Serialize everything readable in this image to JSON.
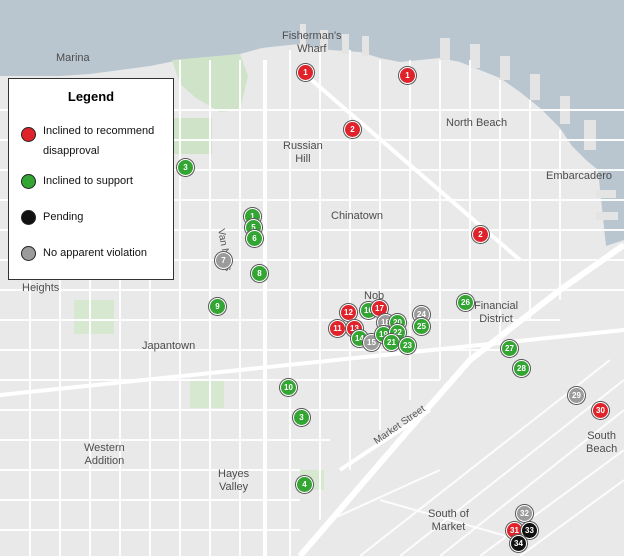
{
  "colors": {
    "water": "#b9c6d0",
    "land": "#e9e9e9",
    "park": "#cfe3c9",
    "road": "#ffffff",
    "red": "#e0232a",
    "green": "#33a532",
    "black": "#111111",
    "gray": "#9b9b9b"
  },
  "legend": {
    "title": "Legend",
    "items": [
      {
        "label": "Inclined to recommend disapproval",
        "line1": "Inclined to recommend",
        "line2": "disapproval",
        "color": "#e0232a",
        "icon": "red-circle-icon"
      },
      {
        "label": "Inclined to support",
        "color": "#33a532",
        "icon": "green-circle-icon"
      },
      {
        "label": "Pending",
        "color": "#111111",
        "icon": "black-circle-icon"
      },
      {
        "label": "No apparent violation",
        "color": "#9b9b9b",
        "icon": "gray-circle-icon"
      }
    ]
  },
  "places": [
    {
      "id": "marina",
      "text": "Marina"
    },
    {
      "id": "fishermans",
      "text": "Fisherman's\nWharf"
    },
    {
      "id": "north-beach",
      "text": "North Beach"
    },
    {
      "id": "russian-hill",
      "text": "Russian\nHill"
    },
    {
      "id": "embarcadero",
      "text": "Embarcadero"
    },
    {
      "id": "chinatown",
      "text": "Chinatown"
    },
    {
      "id": "heights",
      "text": "Heights"
    },
    {
      "id": "nob",
      "text": "Nob"
    },
    {
      "id": "financial",
      "text": "Financial\nDistrict"
    },
    {
      "id": "japantown",
      "text": "Japantown"
    },
    {
      "id": "western",
      "text": "Western\nAddition"
    },
    {
      "id": "hayes",
      "text": "Hayes\nValley"
    },
    {
      "id": "south-beach",
      "text": "South\nBeach"
    },
    {
      "id": "som",
      "text": "South of\nMarket"
    }
  ],
  "streets": [
    {
      "id": "van-ness",
      "text": "Van Ness"
    },
    {
      "id": "market",
      "text": "Market Street"
    }
  ],
  "markers": [
    {
      "n": "1",
      "status": "red"
    },
    {
      "n": "1",
      "status": "red"
    },
    {
      "n": "2",
      "status": "red"
    },
    {
      "n": "2",
      "status": "red"
    },
    {
      "n": "3",
      "status": "green"
    },
    {
      "n": "1",
      "status": "green"
    },
    {
      "n": "5",
      "status": "green"
    },
    {
      "n": "6",
      "status": "green"
    },
    {
      "n": "7",
      "status": "gray"
    },
    {
      "n": "8",
      "status": "green"
    },
    {
      "n": "9",
      "status": "green"
    },
    {
      "n": "26",
      "status": "green"
    },
    {
      "n": "12",
      "status": "red"
    },
    {
      "n": "16",
      "status": "green"
    },
    {
      "n": "17",
      "status": "red"
    },
    {
      "n": "24",
      "status": "gray"
    },
    {
      "n": "11",
      "status": "red"
    },
    {
      "n": "13",
      "status": "red"
    },
    {
      "n": "18",
      "status": "gray"
    },
    {
      "n": "20",
      "status": "green"
    },
    {
      "n": "25",
      "status": "green"
    },
    {
      "n": "14",
      "status": "green"
    },
    {
      "n": "15",
      "status": "gray"
    },
    {
      "n": "19",
      "status": "green"
    },
    {
      "n": "22",
      "status": "green"
    },
    {
      "n": "21",
      "status": "green"
    },
    {
      "n": "23",
      "status": "green"
    },
    {
      "n": "27",
      "status": "green"
    },
    {
      "n": "28",
      "status": "green"
    },
    {
      "n": "10",
      "status": "green"
    },
    {
      "n": "29",
      "status": "gray"
    },
    {
      "n": "30",
      "status": "red"
    },
    {
      "n": "3",
      "status": "green"
    },
    {
      "n": "4",
      "status": "green"
    },
    {
      "n": "32",
      "status": "gray"
    },
    {
      "n": "31",
      "status": "red"
    },
    {
      "n": "33",
      "status": "black"
    },
    {
      "n": "34",
      "status": "black"
    }
  ]
}
